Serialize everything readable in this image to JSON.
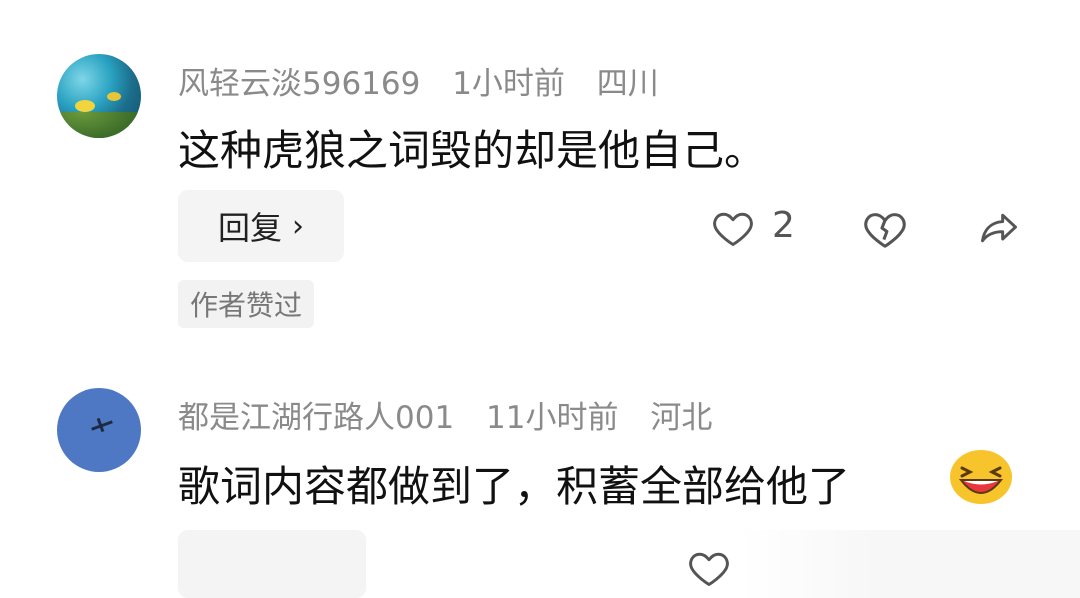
{
  "comments": [
    {
      "username": "风轻云淡596169",
      "time": "1小时前",
      "location": "四川",
      "text": "这种虎狼之词毁的却是他自己。",
      "reply_label": "回复",
      "reply_chevron": "›",
      "like_count": "2",
      "author_liked": "作者赞过",
      "avatar_icon": "coral-reef-avatar",
      "icons": [
        "heart-outline-icon",
        "broken-heart-icon",
        "share-arrow-icon",
        "chevron-right-icon"
      ]
    },
    {
      "username": "都是江湖行路人001",
      "time": "11小时前",
      "location": "河北",
      "text": "歌词内容都做到了，积蓄全部给他了",
      "emoji": "laughing-emoji",
      "avatar_icon": "airplane-sky-avatar",
      "icons": [
        "heart-outline-icon"
      ]
    }
  ],
  "colors": {
    "meta_text": "#8a8a8a",
    "body_text": "#111111",
    "button_bg": "#f4f4f4",
    "icon_stroke": "#555555"
  }
}
